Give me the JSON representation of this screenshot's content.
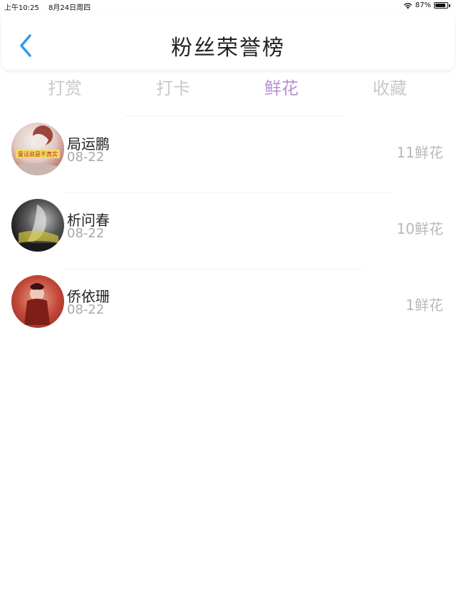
{
  "status_bar": {
    "time": "上午10:25",
    "date": "8月24日周四",
    "battery_percent": "87%",
    "battery_level": 0.87,
    "wifi_icon": "wifi-icon"
  },
  "header": {
    "title": "粉丝荣誉榜",
    "back_icon": "chevron-left-icon",
    "accent_color": "#2f9bea"
  },
  "tabs": [
    {
      "label": "打赏",
      "active": false
    },
    {
      "label": "打卡",
      "active": false
    },
    {
      "label": "鲜花",
      "active": true
    },
    {
      "label": "收藏",
      "active": false
    }
  ],
  "active_tab_color": "#b891d6",
  "fans": [
    {
      "name": "局运鹏",
      "date": "08-22",
      "count": "11鲜花",
      "avatar_text": "童话就是不真实"
    },
    {
      "name": "析问春",
      "date": "08-22",
      "count": "10鲜花"
    },
    {
      "name": "侨依珊",
      "date": "08-22",
      "count": "1鲜花"
    }
  ]
}
